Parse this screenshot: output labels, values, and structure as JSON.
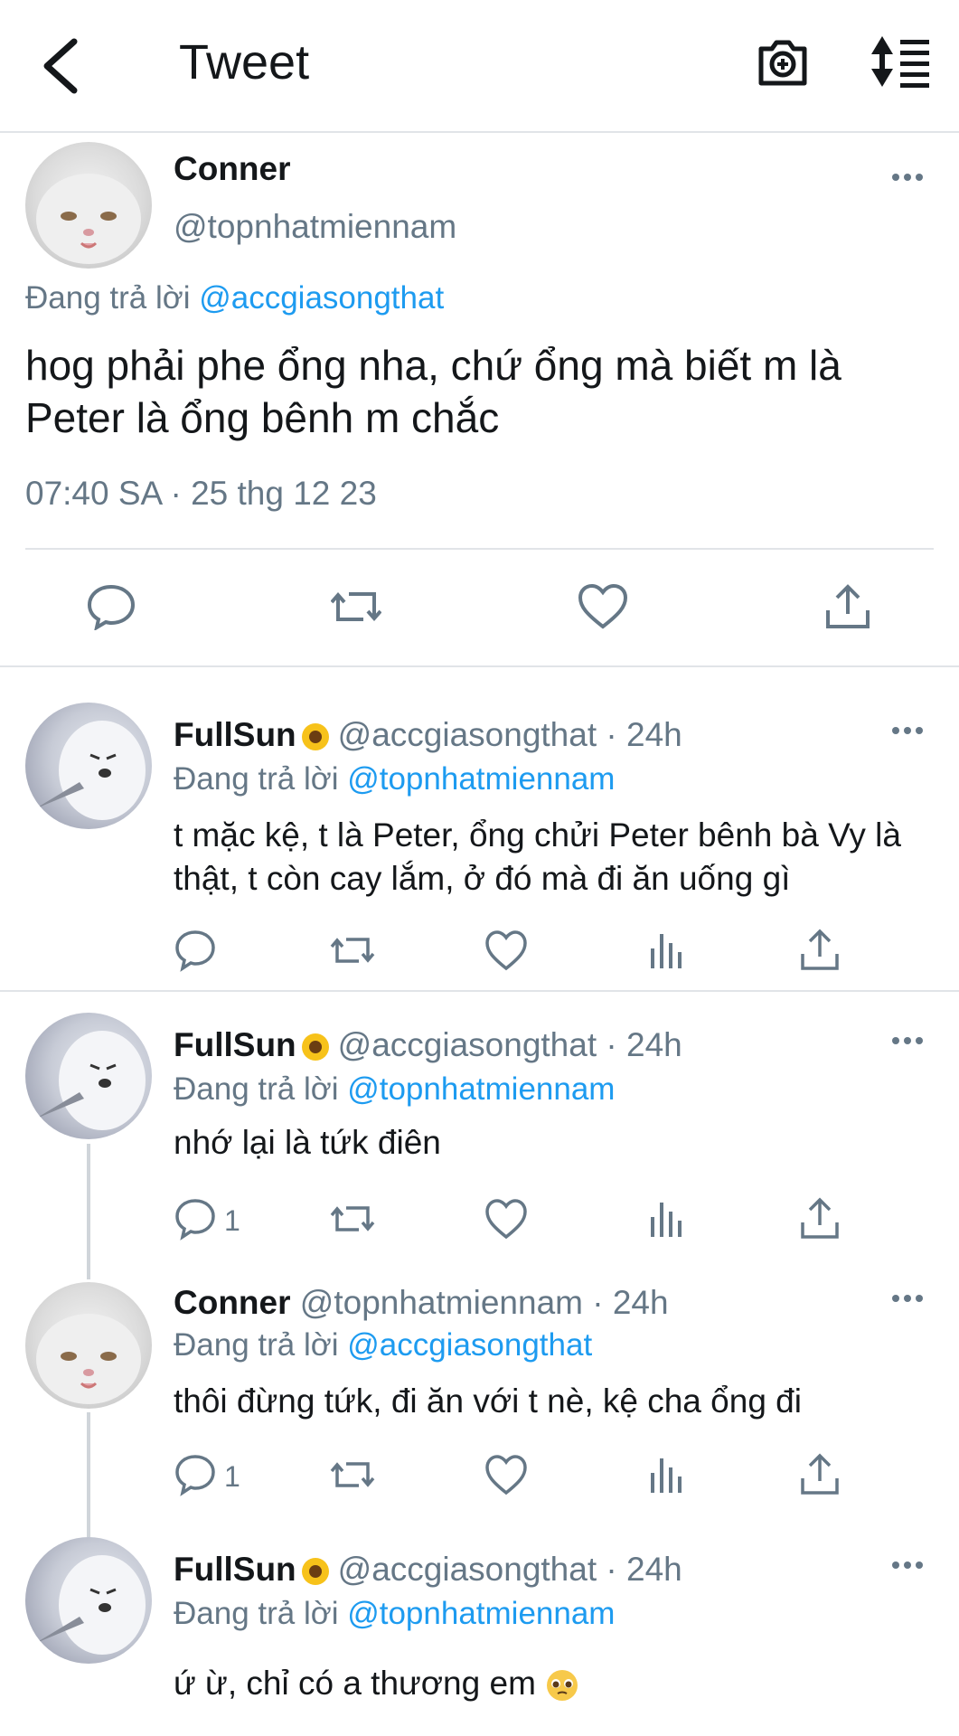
{
  "header": {
    "title": "Tweet",
    "back_icon": "chevron-left-icon",
    "camera_icon": "camera-add-icon",
    "sort_icon": "sort-icon"
  },
  "main_tweet": {
    "name": "Conner",
    "handle": "@topnhatmiennam",
    "replying_prefix": "Đang trả lời",
    "replying_to": "@accgiasongthat",
    "text": "hog phải phe ổng nha, chứ ổng mà biết m là Peter là ổng bênh m chắc",
    "timestamp": "07:40 SA · 25 thg 12 23"
  },
  "replies": [
    {
      "name": "FullSun",
      "meta": "@accgiasongthat · 24h",
      "replying_prefix": "Đang trả lời",
      "replying_to": "@topnhatmiennam",
      "text": "t mặc kệ, t là Peter, ổng chửi Peter bênh bà Vy là thật, t còn cay lắm, ở đó mà đi ăn uống gì",
      "reply_count": ""
    },
    {
      "name": "FullSun",
      "meta": "@accgiasongthat · 24h",
      "replying_prefix": "Đang trả lời",
      "replying_to": "@topnhatmiennam",
      "text": "nhớ lại là tứk điên",
      "reply_count": "1"
    },
    {
      "name": "Conner",
      "meta": "@topnhatmiennam · 24h",
      "replying_prefix": "Đang trả lời",
      "replying_to": "@accgiasongthat",
      "text": "thôi đừng tứk, đi ăn với t nè, kệ cha ổng đi",
      "reply_count": "1"
    },
    {
      "name": "FullSun",
      "meta": "@accgiasongthat · 24h",
      "replying_prefix": "Đang trả lời",
      "replying_to": "@topnhatmiennam",
      "text": "ứ ừ, chỉ có a thương em",
      "reply_count": ""
    }
  ],
  "colors": {
    "accent": "#1d9bf0",
    "secondary_text": "#657786",
    "divider": "#e1e4e8"
  }
}
